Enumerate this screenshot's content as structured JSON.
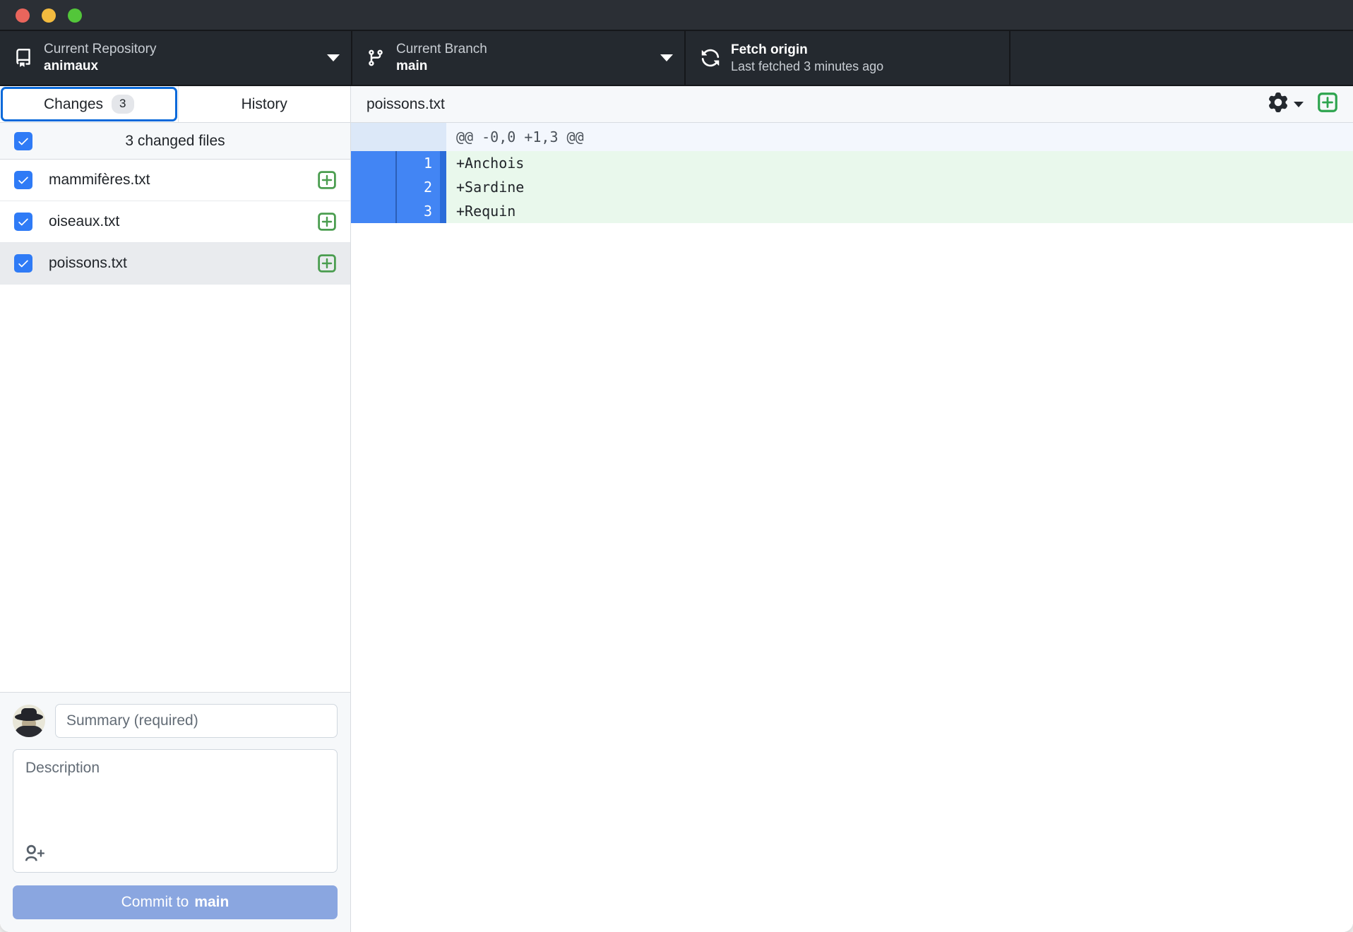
{
  "window": {
    "traffic_lights": [
      "close",
      "minimize",
      "maximize"
    ]
  },
  "toolbar": {
    "repository": {
      "icon": "repo-icon",
      "label": "Current Repository",
      "value": "animaux"
    },
    "branch": {
      "icon": "git-branch-icon",
      "label": "Current Branch",
      "value": "main"
    },
    "fetch": {
      "icon": "sync-icon",
      "title": "Fetch origin",
      "subtitle": "Last fetched 3 minutes ago"
    }
  },
  "sidebar": {
    "tabs": [
      {
        "label": "Changes",
        "count": "3",
        "active": true
      },
      {
        "label": "History",
        "count": "",
        "active": false
      }
    ],
    "changed_files_header": "3 changed files",
    "files": [
      {
        "name": "mammifères.txt",
        "checked": true,
        "status": "added",
        "selected": false
      },
      {
        "name": "oiseaux.txt",
        "checked": true,
        "status": "added",
        "selected": false
      },
      {
        "name": "poissons.txt",
        "checked": true,
        "status": "added",
        "selected": true
      }
    ],
    "commit": {
      "summary_value": "",
      "summary_placeholder": "Summary (required)",
      "description_value": "",
      "description_placeholder": "Description",
      "coauthor_icon": "add-person-icon",
      "button_prefix": "Commit to ",
      "button_branch": "main"
    }
  },
  "diff": {
    "filename": "poissons.txt",
    "actions": [
      {
        "icon": "gear-icon",
        "name": "diff-options"
      },
      {
        "icon": "plus-square-icon",
        "name": "expand-all"
      }
    ],
    "hunk_header": "@@ -0,0 +1,3 @@",
    "lines": [
      {
        "old": "",
        "new": "1",
        "text": "+Anchois"
      },
      {
        "old": "",
        "new": "2",
        "text": "+Sardine"
      },
      {
        "old": "",
        "new": "3",
        "text": "+Requin"
      }
    ]
  },
  "colors": {
    "accent_blue": "#0969da",
    "checkbox_blue": "#2f7bf6",
    "gutter_blue": "#4285f4",
    "added_green_bg": "#e9f8ec",
    "status_green": "#4a9d4f",
    "toolbar_dark": "#24292f",
    "commit_button": "#8aa6e0"
  }
}
